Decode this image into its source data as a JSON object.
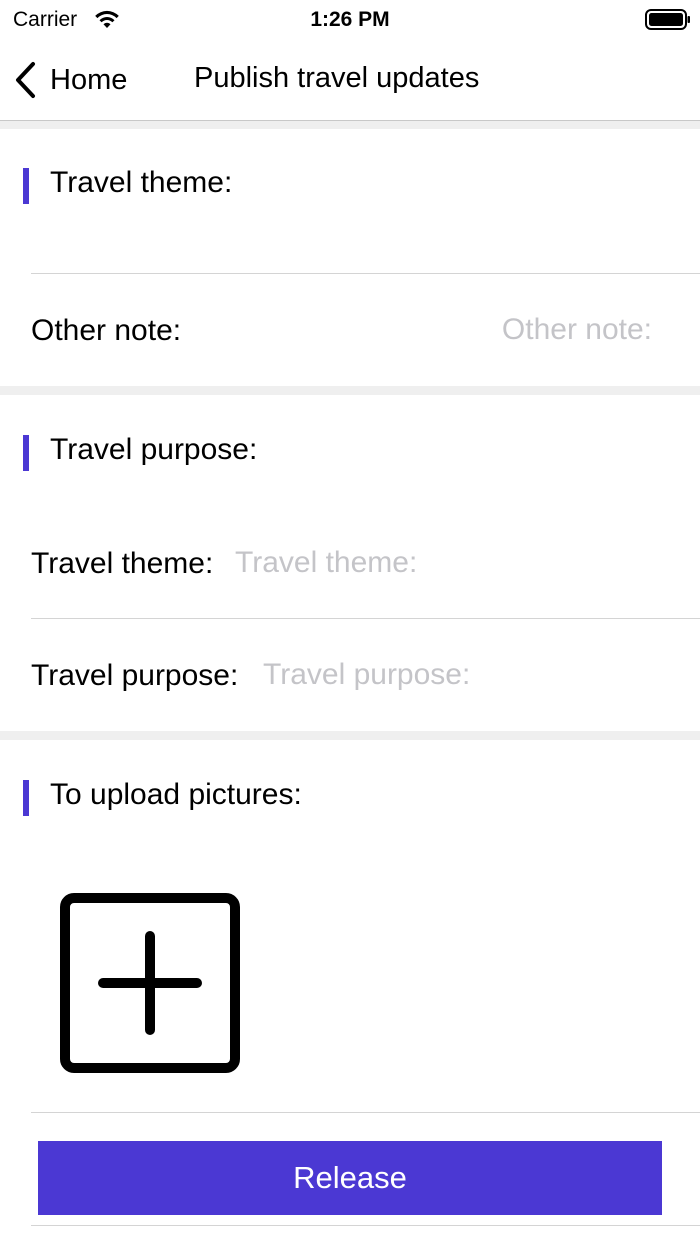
{
  "status_bar": {
    "carrier": "Carrier",
    "time": "1:26 PM",
    "wifi_icon": "wifi-icon",
    "battery_icon": "battery-icon"
  },
  "nav": {
    "back_label": "Home",
    "back_icon": "chevron-left-icon",
    "title": "Publish travel updates"
  },
  "sections": {
    "theme": {
      "title": "Travel theme:",
      "other_note": {
        "label": "Other note:",
        "placeholder": "Other note:",
        "value": ""
      }
    },
    "purpose": {
      "title": "Travel purpose:",
      "theme_field": {
        "label": "Travel theme:",
        "placeholder": "Travel theme:",
        "value": ""
      },
      "purpose_field": {
        "label": "Travel purpose:",
        "placeholder": "Travel purpose:",
        "value": ""
      }
    },
    "pictures": {
      "title": "To upload pictures:",
      "add_icon": "add-square-icon"
    }
  },
  "actions": {
    "release_label": "Release"
  },
  "colors": {
    "accent": "#4b38d3",
    "separator": "#efefef",
    "placeholder": "#c4c4c8"
  }
}
